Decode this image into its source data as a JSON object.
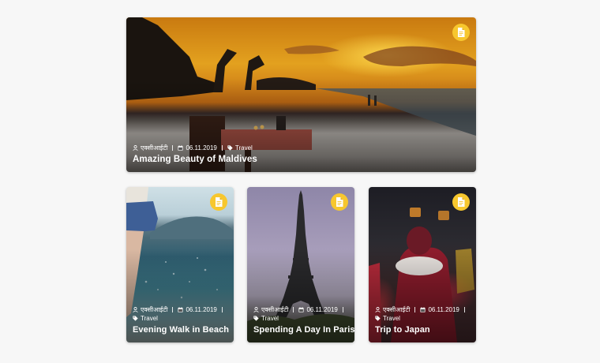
{
  "cards": [
    {
      "author": "एक्सीआईटी",
      "date": "06.11.2019",
      "category": "Travel",
      "title": "Amazing Beauty of Maldives",
      "badge_icon": "document-icon"
    },
    {
      "author": "एक्सीआईटी",
      "date": "06.11.2019",
      "category": "Travel",
      "title": "Evening Walk in Beach",
      "badge_icon": "document-icon"
    },
    {
      "author": "एक्सीआईटी",
      "date": "06.11.2019",
      "category": "Travel",
      "title": "Spending A Day In Paris",
      "badge_icon": "document-icon"
    },
    {
      "author": "एक्सीआईटी",
      "date": "06.11.2019",
      "category": "Travel",
      "title": "Trip to Japan",
      "badge_icon": "document-icon"
    }
  ],
  "colors": {
    "badge": "#f7c72e",
    "page_bg": "#f7f7f7",
    "text": "#ffffff"
  }
}
